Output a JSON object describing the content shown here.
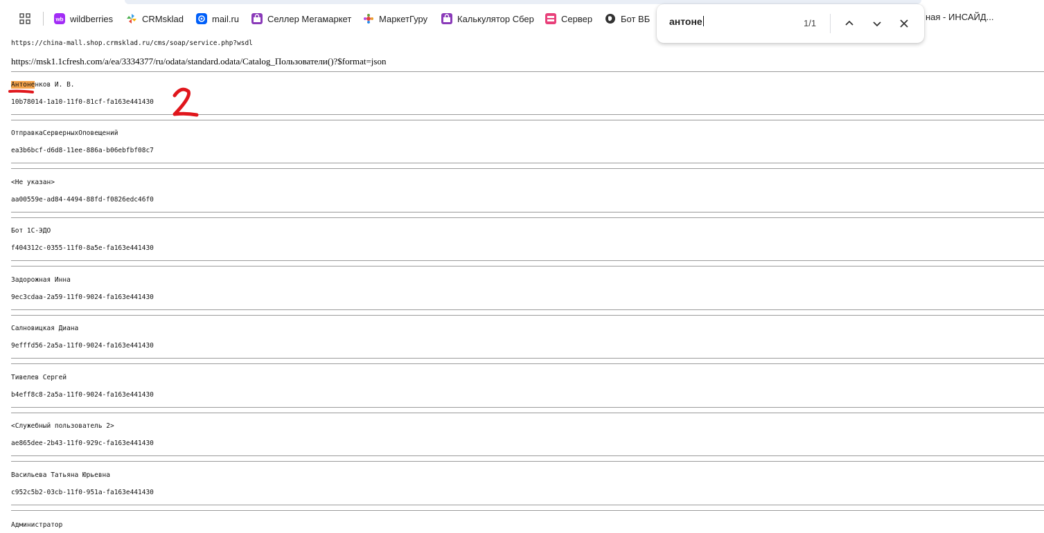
{
  "bookmarks": [
    {
      "label": "wildberries",
      "icon": "wildberries-logo-icon",
      "color": "#a22cf6"
    },
    {
      "label": "CRMsklad",
      "icon": "crmsklad-pinwheel-icon",
      "color": "#3aa0e8"
    },
    {
      "label": "mail.ru",
      "icon": "mailru-at-icon",
      "color": "#005ff9"
    },
    {
      "label": "Селлер Мегамаркет",
      "icon": "megamarket-bag-icon",
      "color": "#8a3ab9"
    },
    {
      "label": "МаркетГуру",
      "icon": "marketguru-icon",
      "color": "#e04040"
    },
    {
      "label": "Калькулятор Сбер",
      "icon": "megamarket-bag-icon",
      "color": "#8a3ab9"
    },
    {
      "label": "Сервер",
      "icon": "server-icon",
      "color": "#e8407a"
    },
    {
      "label": "Бот ВБ",
      "icon": "globe-icon",
      "color": "#333333"
    }
  ],
  "tab_tail": "ная - ИНСАЙД...",
  "find": {
    "query": "антоне",
    "count": "1/1"
  },
  "page": {
    "soap_url": "https://china-mall.shop.crmsklad.ru/cms/soap/service.php?wsdl",
    "odata_url": "https://msk1.1cfresh.com/a/ea/3334377/ru/odata/standard.odata/Catalog_Пользователи()?$format=json",
    "first_user": {
      "highlight": "Антоне",
      "rest": "нков И. В.",
      "id": "10b78014-1a10-11f0-81cf-fa163e441430"
    },
    "users": [
      {
        "name": "ОтправкаСерверныхОповещений",
        "id": "ea3b6bcf-d6d8-11ee-886a-b06ebfbf08c7"
      },
      {
        "name": "<Не указан>",
        "id": "aa00559e-ad84-4494-88fd-f0826edc46f0"
      },
      {
        "name": "Бот 1С-ЭДО",
        "id": "f404312c-0355-11f0-8a5e-fa163e441430"
      },
      {
        "name": "Задорожная Инна",
        "id": "9ec3cdaa-2a59-11f0-9024-fa163e441430"
      },
      {
        "name": "Салновицкая Диана",
        "id": "9efffd56-2a5a-11f0-9024-fa163e441430"
      },
      {
        "name": "Тивелев Сергей",
        "id": "b4eff8c8-2a5a-11f0-9024-fa163e441430"
      },
      {
        "name": "<Служебный пользователь 2>",
        "id": "ae865dee-2b43-11f0-929c-fa163e441430"
      },
      {
        "name": "Васильева Татьяна Юрьевна",
        "id": "c952c5b2-03cb-11f0-951a-fa163e441430"
      }
    ],
    "last_name": "Администратор"
  },
  "annotation": {
    "number": "2",
    "color": "#e0161c"
  }
}
